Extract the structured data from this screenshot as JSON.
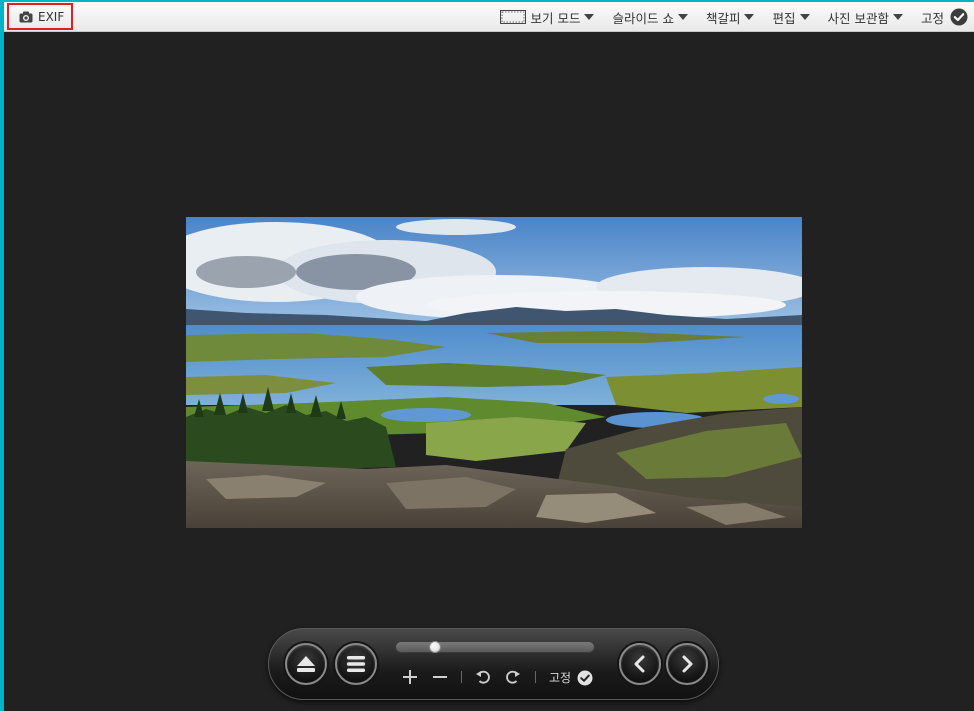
{
  "toolbar": {
    "exif_label": "EXIF",
    "menu": [
      {
        "label": "보기 모드"
      },
      {
        "label": "슬라이드 쇼"
      },
      {
        "label": "책갈피"
      },
      {
        "label": "편집"
      },
      {
        "label": "사진 보관함"
      }
    ],
    "pin_label": "고정"
  },
  "controls": {
    "pin_label": "고정",
    "slider_position": 0.18
  },
  "icons": {
    "camera": "camera-icon",
    "viewmode": "fullscreen-frame-icon",
    "caret": "triangle-down-icon",
    "check": "check-circle-icon",
    "eject": "eject-icon",
    "menu": "hamburger-icon",
    "zoom_in": "plus-icon",
    "zoom_out": "minus-icon",
    "rotate_left": "rotate-left-icon",
    "rotate_right": "rotate-right-icon",
    "prev": "chevron-left-icon",
    "next": "chevron-right-icon"
  },
  "colors": {
    "background": "#212121",
    "toolbar": "#f2f2f2",
    "exif_border": "#e02020",
    "frame_accent": "#00b4c8"
  }
}
